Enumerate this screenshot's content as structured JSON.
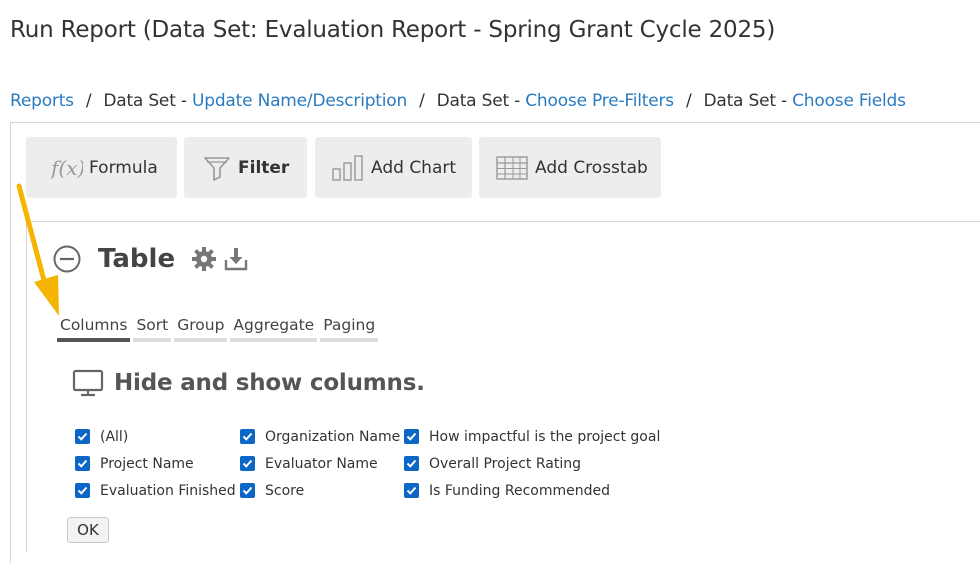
{
  "page": {
    "title": "Run Report (Data Set: Evaluation Report - Spring Grant Cycle 2025)"
  },
  "breadcrumb": {
    "reports": "Reports",
    "sep": "/",
    "ds_prefix": "Data Set - ",
    "update_name": "Update Name/Description",
    "prefilters": "Choose Pre-Filters",
    "fields": "Choose Fields"
  },
  "toolbar": {
    "formula": "Formula",
    "filter": "Filter",
    "add_chart": "Add Chart",
    "add_crosstab": "Add Crosstab"
  },
  "table_section": {
    "title": "Table",
    "tabs": [
      "Columns",
      "Sort",
      "Group",
      "Aggregate",
      "Paging"
    ],
    "active_tab": "Columns",
    "hide_show_title": "Hide and show columns.",
    "ok_label": "OK"
  },
  "columns": [
    [
      {
        "label": "(All)",
        "checked": true
      },
      {
        "label": "Project Name",
        "checked": true
      },
      {
        "label": "Evaluation Finished",
        "checked": true
      }
    ],
    [
      {
        "label": "Organization Name",
        "checked": true
      },
      {
        "label": "Evaluator Name",
        "checked": true
      },
      {
        "label": "Score",
        "checked": true
      }
    ],
    [
      {
        "label": "How impactful is the project goal",
        "checked": true
      },
      {
        "label": "Overall Project Rating",
        "checked": true
      },
      {
        "label": "Is Funding Recommended",
        "checked": true
      }
    ]
  ],
  "colors": {
    "link": "#2a7bc0",
    "checkbox": "#0b66c6",
    "annotation_arrow": "#f5b400"
  },
  "icons": {
    "formula": "fx-icon",
    "filter": "funnel-icon",
    "chart": "bar-chart-icon",
    "crosstab": "crosstab-grid-icon",
    "collapse": "minus-circle-icon",
    "settings": "gear-icon",
    "download": "download-icon",
    "monitor": "monitor-icon"
  }
}
